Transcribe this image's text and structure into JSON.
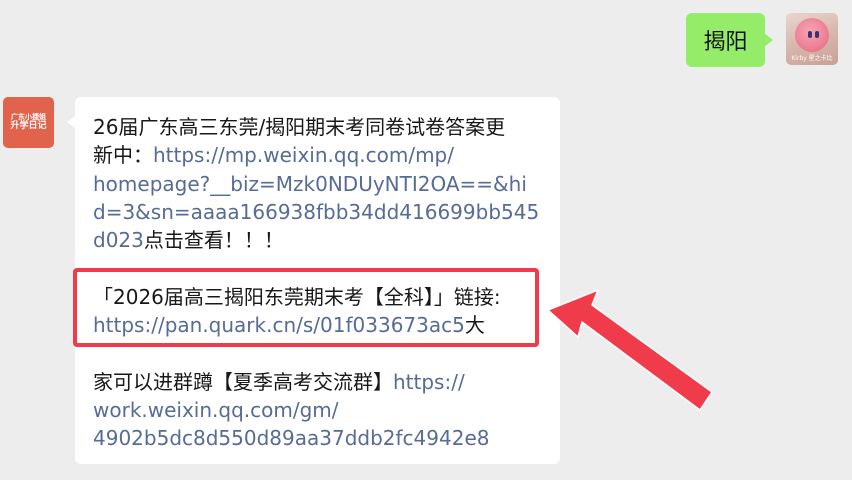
{
  "outgoing": {
    "text": "揭阳",
    "avatar_caption": "Kirby 星之卡比"
  },
  "incoming": {
    "avatar_line1": "广东小捷姐",
    "avatar_line2": "升学日记",
    "para1": {
      "l1": "26届广东高三东莞/揭阳期末考同卷试卷答案更",
      "l2_text": "新中：",
      "l2_link": "https://mp.weixin.qq.com/mp/",
      "l3": "homepage?__biz=Mzk0NDUyNTI2OA==&hi",
      "l4": "d=3&sn=aaaa166938fbb34dd416699bb545",
      "l5_link": "d023",
      "l5_text": "点击查看！！！"
    },
    "para2": {
      "l1": "「2026届高三揭阳东莞期末考【全科】」链接:",
      "l2_link": "https://pan.quark.cn/s/01f033673ac5",
      "l2_text": "大"
    },
    "para3": {
      "l1_text": "家可以进群蹲【夏季高考交流群】",
      "l1_link": "https://",
      "l2": "work.weixin.qq.com/gm/",
      "l3": "4902b5dc8d550d89aa37ddb2fc4942e8"
    }
  },
  "colors": {
    "background": "#ededed",
    "outgoing_bubble": "#95ec69",
    "link": "#576b95",
    "highlight": "#ef3b4a",
    "avatar_brand": "#e2634b"
  }
}
